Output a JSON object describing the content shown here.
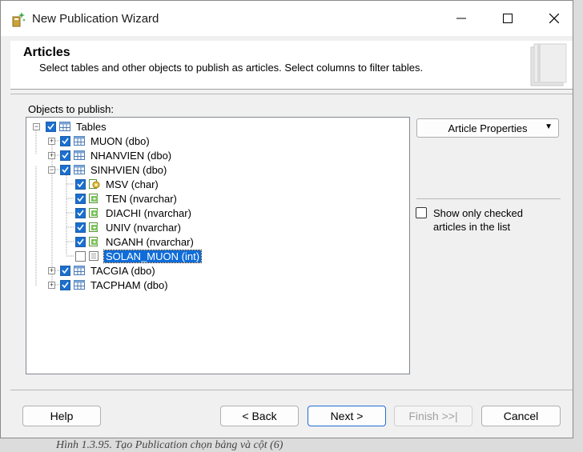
{
  "window": {
    "title": "New Publication Wizard"
  },
  "header": {
    "title": "Articles",
    "subtitle": "Select tables and other objects to publish as articles. Select columns to filter tables."
  },
  "objects_label": "Objects to publish:",
  "tree": {
    "root": "Tables",
    "muon": "MUON (dbo)",
    "nhanvien": "NHANVIEN (dbo)",
    "sinhvien": "SINHVIEN (dbo)",
    "col_msv": "MSV (char)",
    "col_ten": "TEN (nvarchar)",
    "col_diachi": "DIACHI (nvarchar)",
    "col_univ": "UNIV (nvarchar)",
    "col_nganh": "NGANH (nvarchar)",
    "col_solan": "SOLAN_MUON (int)",
    "tacgia": "TACGIA (dbo)",
    "tacpham": "TACPHAM (dbo)"
  },
  "article_properties_label": "Article Properties",
  "show_only_checked": "Show only checked articles in the list",
  "buttons": {
    "help": "Help",
    "back": "< Back",
    "next": "Next >",
    "finish": "Finish >>|",
    "cancel": "Cancel"
  },
  "caption": "Hình 1.3.95. Tạo Publication chọn bảng và cột (6)"
}
